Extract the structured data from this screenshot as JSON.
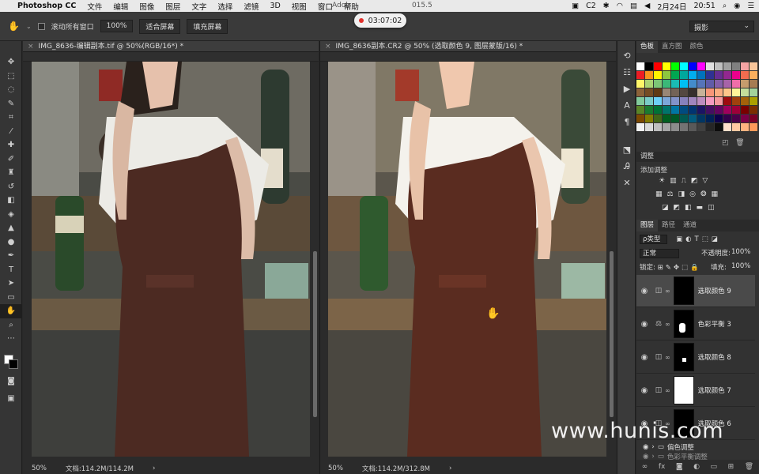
{
  "menubar": {
    "apple": "",
    "app_name": "Photoshop CC",
    "items": [
      "文件",
      "编辑",
      "图像",
      "图层",
      "文字",
      "选择",
      "滤镜",
      "3D",
      "视图",
      "窗口",
      "帮助"
    ],
    "window_title": "Adob",
    "window_title_tail": "015.5",
    "status_c": "C2",
    "date": "2月24日",
    "time": "20:51"
  },
  "recording": {
    "timer": "03:07:02"
  },
  "options_bar": {
    "scroll_all_label": "滚动所有窗口",
    "zoom_100": "100%",
    "fit_screen": "适合屏幕",
    "fill_screen": "填充屏幕",
    "workspace": "摄影"
  },
  "doc_left": {
    "tab_title": "IMG_8636-编辑副本.tif @ 50%(RGB/16*) *",
    "zoom": "50%",
    "doc_size": "文档:114.2M/114.2M"
  },
  "doc_right": {
    "tab_title": "IMG_8636副本.CR2 @ 50% (选取颜色 9, 图层蒙版/16) *",
    "zoom": "50%",
    "doc_size": "文档:114.2M/312.8M"
  },
  "swatches_panel": {
    "tabs": [
      "色板",
      "直方图",
      "颜色"
    ]
  },
  "adjustments_panel": {
    "title": "调整",
    "subtitle": "添加调整"
  },
  "layers_panel": {
    "tabs": [
      "图层",
      "路径",
      "通道"
    ],
    "kind_filter": "ρ类型",
    "blend_mode": "正常",
    "opacity_label": "不透明度:",
    "opacity_value": "100%",
    "lock_label": "锁定:",
    "fill_label": "填充:",
    "fill_value": "100%",
    "layers": [
      {
        "name": "选取颜色 9",
        "selected": true
      },
      {
        "name": "色彩平衡 3",
        "selected": false
      },
      {
        "name": "选取颜色 8",
        "selected": false
      },
      {
        "name": "选取颜色 7",
        "selected": false
      },
      {
        "name": "选取颜色 6",
        "selected": false
      }
    ],
    "group_name": "偏色调整",
    "group_name_2": "色彩平衡调整"
  },
  "watermark": "www.hunis.com",
  "colors": {
    "panel_bg": "#323232",
    "canvas_bg": "#2b2b2b",
    "selected_layer": "#4a4a4a"
  }
}
